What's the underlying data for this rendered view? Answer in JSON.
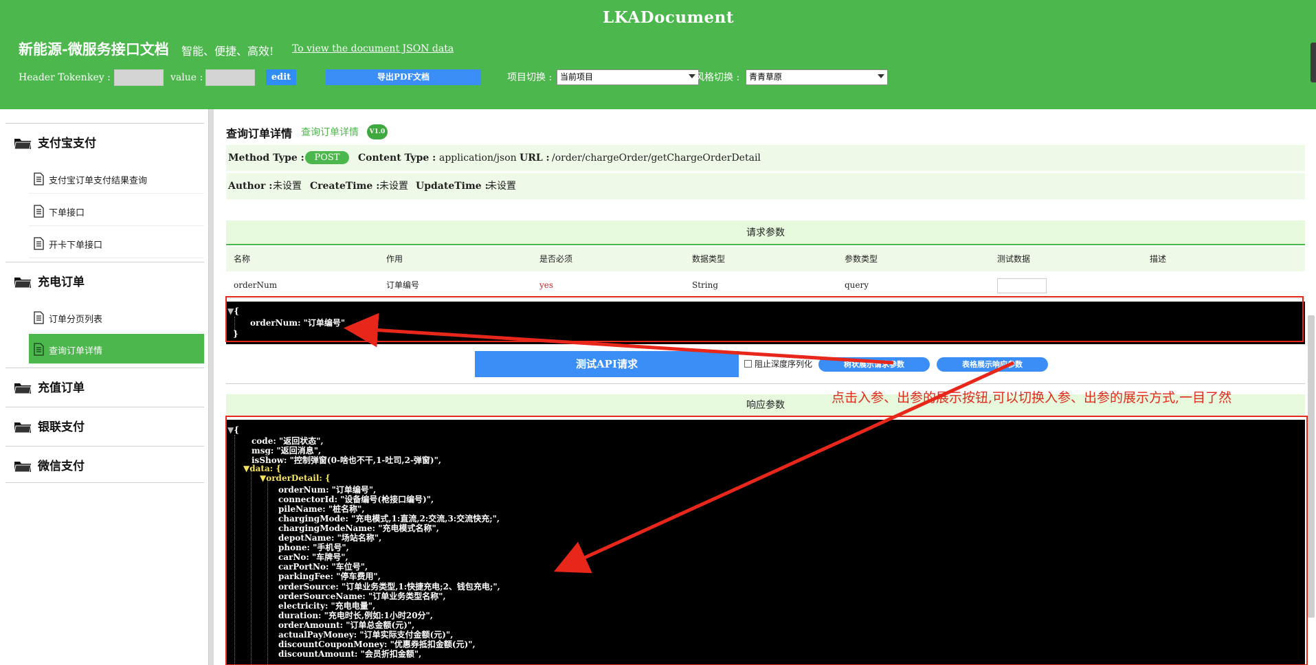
{
  "header": {
    "brand": "LKADocument",
    "title": "新能源-微服务接口文档",
    "slogan": "智能、便捷、高效!",
    "json_link": "To view the document JSON data",
    "token_label": "Header Token",
    "key_label": "key :",
    "value_label": "value :",
    "edit_label": "edit",
    "pdf_label": "导出PDF文档",
    "project_label": "项目切换 :",
    "project_value": "当前项目",
    "style_label": "风格切换 :",
    "style_value": "青青草原"
  },
  "sidebar": {
    "groups": [
      {
        "label": "支付宝支付",
        "items": [
          "支付宝订单支付结果查询",
          "下单接口",
          "开卡下单接口"
        ]
      },
      {
        "label": "充电订单",
        "items": [
          "订单分页列表",
          "查询订单详情"
        ]
      },
      {
        "label": "充值订单",
        "items": []
      },
      {
        "label": "银联支付",
        "items": []
      },
      {
        "label": "微信支付",
        "items": []
      }
    ],
    "active_item": "查询订单详情"
  },
  "api": {
    "title": "查询订单详情",
    "subtitle": "查询订单详情",
    "version": "V1.0",
    "method_label": "Method Type :",
    "method": "POST",
    "content_type_label": "Content Type :",
    "content_type": "application/json",
    "url_label": "URL :",
    "url": "/order/chargeOrder/getChargeOrderDetail",
    "author_label": "Author :",
    "author": "未设置",
    "create_label": "CreateTime :",
    "create_time": "未设置",
    "update_label": "UpdateTime :",
    "update_time": "未设置"
  },
  "request": {
    "caption": "请求参数",
    "columns": [
      "名称",
      "作用",
      "是否必须",
      "数据类型",
      "参数类型",
      "测试数据",
      "描述"
    ],
    "rows": [
      {
        "name": "orderNum",
        "desc": "订单编号",
        "required": "yes",
        "type": "String",
        "param_type": "query"
      }
    ],
    "json_open": "{",
    "json_line": "orderNum: \"订单编号\"",
    "json_close": "}"
  },
  "actions": {
    "test_label": "测试API请求",
    "no_serialize_label": "阻止深度序列化",
    "tree_request_label": "树状展示请求参数",
    "table_response_label": "表格展示响应参数"
  },
  "response": {
    "caption": "响应参数",
    "lines": [
      "code: \"返回状态\",",
      "msg: \"返回消息\",",
      "isShow: \"控制弹窗(0-啥也不干,1-吐司,2-弹窗)\",",
      "data: {",
      "orderDetail: {",
      "orderNum: \"订单编号\",",
      "connectorId: \"设备编号(枪接口编号)\",",
      "pileName: \"桩名称\",",
      "chargingMode: \"充电模式,1:直流,2:交流,3:交流快充;\",",
      "chargingModeName: \"充电模式名称\",",
      "depotName: \"场站名称\",",
      "phone: \"手机号\",",
      "carNo: \"车牌号\",",
      "carPortNo: \"车位号\",",
      "parkingFee: \"停车费用\",",
      "orderSource: \"订单业务类型,1:快捷充电;2、钱包充电;\",",
      "orderSourceName: \"订单业务类型名称\",",
      "electricity: \"充电电量\",",
      "duration: \"充电时长,例如:1小时20分\",",
      "orderAmount: \"订单总金额(元)\",",
      "actualPayMoney: \"订单实际支付金额(元)\",",
      "discountCouponMoney: \"优惠券抵扣金额(元)\",",
      "discountAmount: \"会员折扣金额\","
    ]
  },
  "annotation": {
    "text": "点击入参、出参的展示按钮,可以切换入参、出参的展示方式,一目了然",
    "color": "#e02a1c"
  },
  "colors": {
    "green": "#4cb74c",
    "blue": "#3a8ef6",
    "light_green": "#e6f9dc"
  }
}
